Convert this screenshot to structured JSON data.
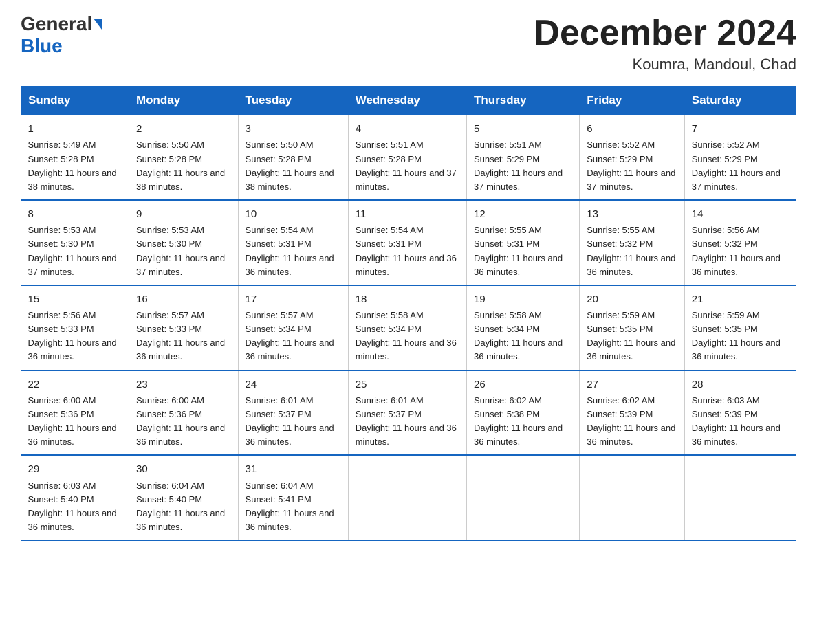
{
  "logo": {
    "line1": "General",
    "arrow": true,
    "line2": "Blue"
  },
  "title": "December 2024",
  "subtitle": "Koumra, Mandoul, Chad",
  "days_of_week": [
    "Sunday",
    "Monday",
    "Tuesday",
    "Wednesday",
    "Thursday",
    "Friday",
    "Saturday"
  ],
  "weeks": [
    [
      {
        "num": "1",
        "sunrise": "5:49 AM",
        "sunset": "5:28 PM",
        "daylight": "11 hours and 38 minutes."
      },
      {
        "num": "2",
        "sunrise": "5:50 AM",
        "sunset": "5:28 PM",
        "daylight": "11 hours and 38 minutes."
      },
      {
        "num": "3",
        "sunrise": "5:50 AM",
        "sunset": "5:28 PM",
        "daylight": "11 hours and 38 minutes."
      },
      {
        "num": "4",
        "sunrise": "5:51 AM",
        "sunset": "5:28 PM",
        "daylight": "11 hours and 37 minutes."
      },
      {
        "num": "5",
        "sunrise": "5:51 AM",
        "sunset": "5:29 PM",
        "daylight": "11 hours and 37 minutes."
      },
      {
        "num": "6",
        "sunrise": "5:52 AM",
        "sunset": "5:29 PM",
        "daylight": "11 hours and 37 minutes."
      },
      {
        "num": "7",
        "sunrise": "5:52 AM",
        "sunset": "5:29 PM",
        "daylight": "11 hours and 37 minutes."
      }
    ],
    [
      {
        "num": "8",
        "sunrise": "5:53 AM",
        "sunset": "5:30 PM",
        "daylight": "11 hours and 37 minutes."
      },
      {
        "num": "9",
        "sunrise": "5:53 AM",
        "sunset": "5:30 PM",
        "daylight": "11 hours and 37 minutes."
      },
      {
        "num": "10",
        "sunrise": "5:54 AM",
        "sunset": "5:31 PM",
        "daylight": "11 hours and 36 minutes."
      },
      {
        "num": "11",
        "sunrise": "5:54 AM",
        "sunset": "5:31 PM",
        "daylight": "11 hours and 36 minutes."
      },
      {
        "num": "12",
        "sunrise": "5:55 AM",
        "sunset": "5:31 PM",
        "daylight": "11 hours and 36 minutes."
      },
      {
        "num": "13",
        "sunrise": "5:55 AM",
        "sunset": "5:32 PM",
        "daylight": "11 hours and 36 minutes."
      },
      {
        "num": "14",
        "sunrise": "5:56 AM",
        "sunset": "5:32 PM",
        "daylight": "11 hours and 36 minutes."
      }
    ],
    [
      {
        "num": "15",
        "sunrise": "5:56 AM",
        "sunset": "5:33 PM",
        "daylight": "11 hours and 36 minutes."
      },
      {
        "num": "16",
        "sunrise": "5:57 AM",
        "sunset": "5:33 PM",
        "daylight": "11 hours and 36 minutes."
      },
      {
        "num": "17",
        "sunrise": "5:57 AM",
        "sunset": "5:34 PM",
        "daylight": "11 hours and 36 minutes."
      },
      {
        "num": "18",
        "sunrise": "5:58 AM",
        "sunset": "5:34 PM",
        "daylight": "11 hours and 36 minutes."
      },
      {
        "num": "19",
        "sunrise": "5:58 AM",
        "sunset": "5:34 PM",
        "daylight": "11 hours and 36 minutes."
      },
      {
        "num": "20",
        "sunrise": "5:59 AM",
        "sunset": "5:35 PM",
        "daylight": "11 hours and 36 minutes."
      },
      {
        "num": "21",
        "sunrise": "5:59 AM",
        "sunset": "5:35 PM",
        "daylight": "11 hours and 36 minutes."
      }
    ],
    [
      {
        "num": "22",
        "sunrise": "6:00 AM",
        "sunset": "5:36 PM",
        "daylight": "11 hours and 36 minutes."
      },
      {
        "num": "23",
        "sunrise": "6:00 AM",
        "sunset": "5:36 PM",
        "daylight": "11 hours and 36 minutes."
      },
      {
        "num": "24",
        "sunrise": "6:01 AM",
        "sunset": "5:37 PM",
        "daylight": "11 hours and 36 minutes."
      },
      {
        "num": "25",
        "sunrise": "6:01 AM",
        "sunset": "5:37 PM",
        "daylight": "11 hours and 36 minutes."
      },
      {
        "num": "26",
        "sunrise": "6:02 AM",
        "sunset": "5:38 PM",
        "daylight": "11 hours and 36 minutes."
      },
      {
        "num": "27",
        "sunrise": "6:02 AM",
        "sunset": "5:39 PM",
        "daylight": "11 hours and 36 minutes."
      },
      {
        "num": "28",
        "sunrise": "6:03 AM",
        "sunset": "5:39 PM",
        "daylight": "11 hours and 36 minutes."
      }
    ],
    [
      {
        "num": "29",
        "sunrise": "6:03 AM",
        "sunset": "5:40 PM",
        "daylight": "11 hours and 36 minutes."
      },
      {
        "num": "30",
        "sunrise": "6:04 AM",
        "sunset": "5:40 PM",
        "daylight": "11 hours and 36 minutes."
      },
      {
        "num": "31",
        "sunrise": "6:04 AM",
        "sunset": "5:41 PM",
        "daylight": "11 hours and 36 minutes."
      },
      {
        "num": "",
        "sunrise": "",
        "sunset": "",
        "daylight": ""
      },
      {
        "num": "",
        "sunrise": "",
        "sunset": "",
        "daylight": ""
      },
      {
        "num": "",
        "sunrise": "",
        "sunset": "",
        "daylight": ""
      },
      {
        "num": "",
        "sunrise": "",
        "sunset": "",
        "daylight": ""
      }
    ]
  ]
}
